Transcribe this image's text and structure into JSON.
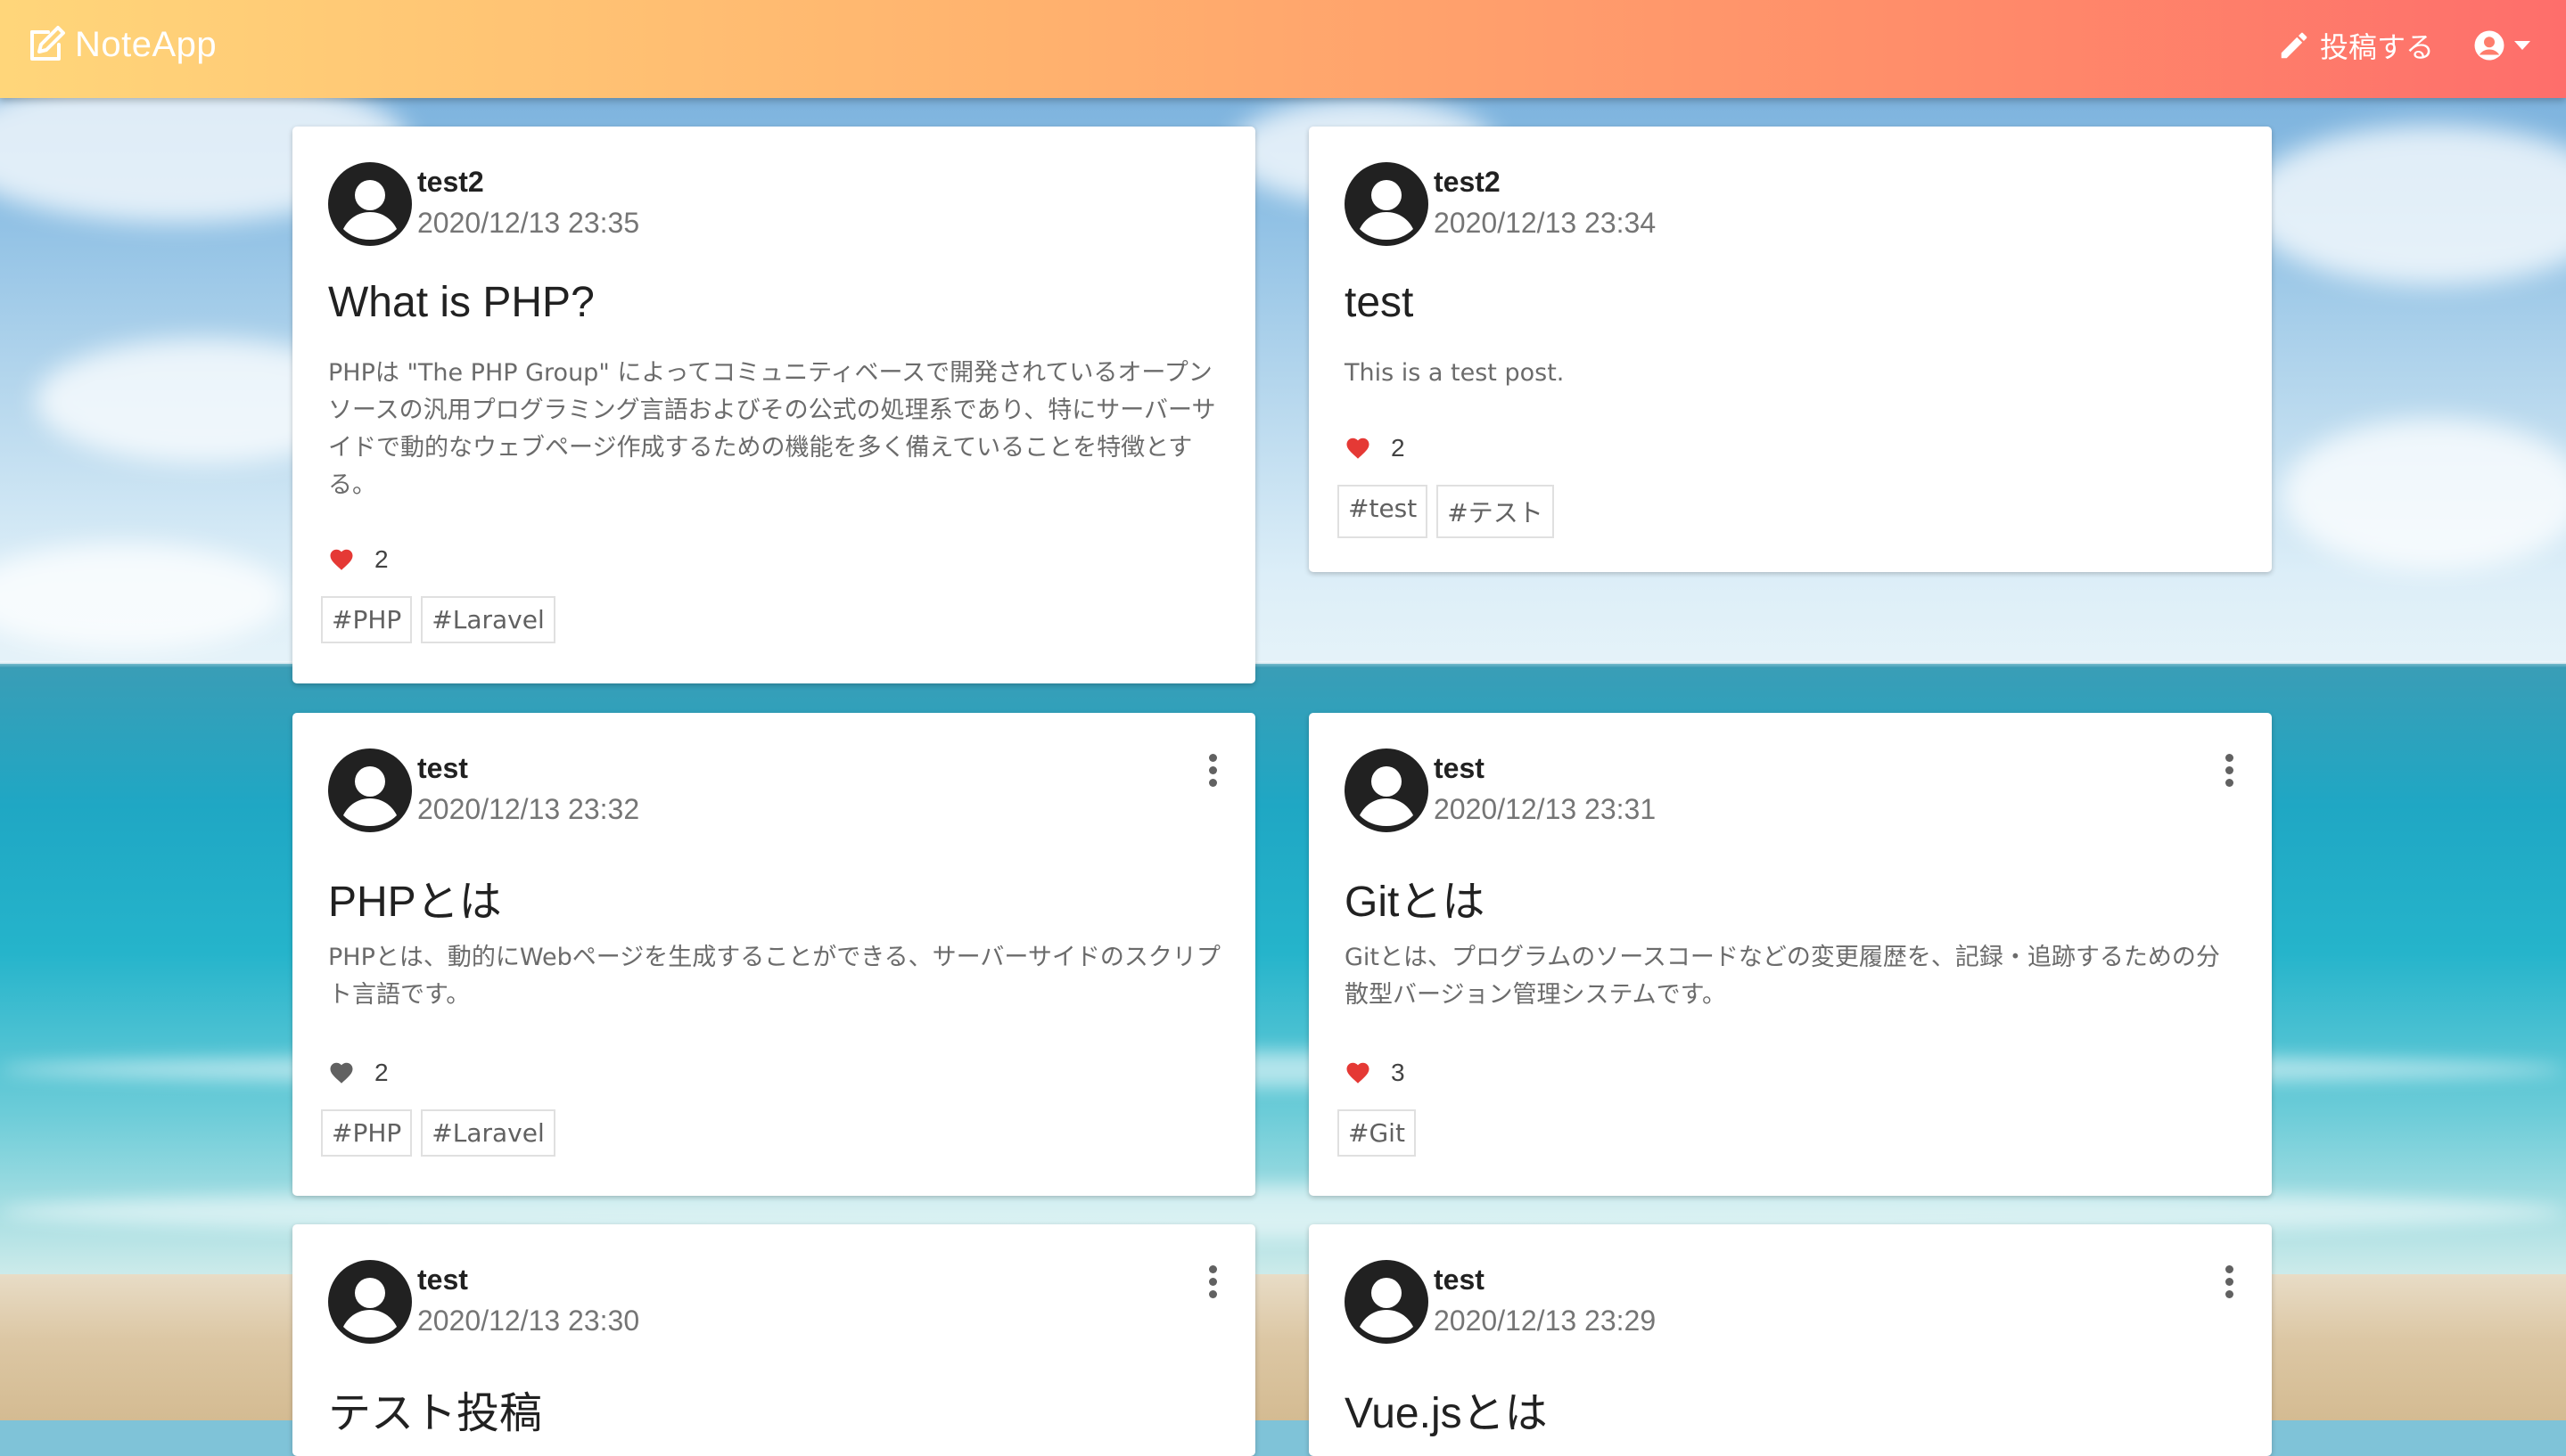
{
  "navbar": {
    "brand": "NoteApp",
    "post_label": "投稿する"
  },
  "colors": {
    "navbar_gradient": [
      "#ffd67a",
      "#ffb26e",
      "#ff8d6a",
      "#fe6e6b"
    ],
    "like_active": "#e53935",
    "like_inactive": "#616161"
  },
  "posts": [
    {
      "user": "test2",
      "date": "2020/12/13 23:35",
      "title": "What is PHP?",
      "body": "PHPは \"The PHP Group\" によってコミュニティベースで開発されているオープンソースの汎用プログラミング言語およびその公式の処理系であり、特にサーバーサイドで動的なウェブページ作成するための機能を多く備えていることを特徴とする。",
      "likes": "2",
      "liked": true,
      "tags": [
        "#PHP",
        "#Laravel"
      ],
      "has_menu": false
    },
    {
      "user": "test2",
      "date": "2020/12/13 23:34",
      "title": "test",
      "body": "This is a test post.",
      "likes": "2",
      "liked": true,
      "tags": [
        "#test",
        "#テスト"
      ],
      "has_menu": false
    },
    {
      "user": "test",
      "date": "2020/12/13 23:32",
      "title": "PHPとは",
      "body": "PHPとは、動的にWebページを生成することができる、サーバーサイドのスクリプト言語です。",
      "likes": "2",
      "liked": false,
      "tags": [
        "#PHP",
        "#Laravel"
      ],
      "has_menu": true
    },
    {
      "user": "test",
      "date": "2020/12/13 23:31",
      "title": "Gitとは",
      "body": "Gitとは、プログラムのソースコードなどの変更履歴を、記録・追跡するための分散型バージョン管理システムです。",
      "likes": "3",
      "liked": true,
      "tags": [
        "#Git"
      ],
      "has_menu": true
    },
    {
      "user": "test",
      "date": "2020/12/13 23:30",
      "title": "テスト投稿",
      "has_menu": true
    },
    {
      "user": "test",
      "date": "2020/12/13 23:29",
      "title": "Vue.jsとは",
      "has_menu": true
    }
  ],
  "icons": {
    "brand": "edit-square-icon",
    "post": "pencil-icon",
    "account": "account-circle-icon",
    "card_menu": "dots-vertical-icon",
    "like": "heart-icon",
    "avatar": "user-avatar-icon"
  }
}
